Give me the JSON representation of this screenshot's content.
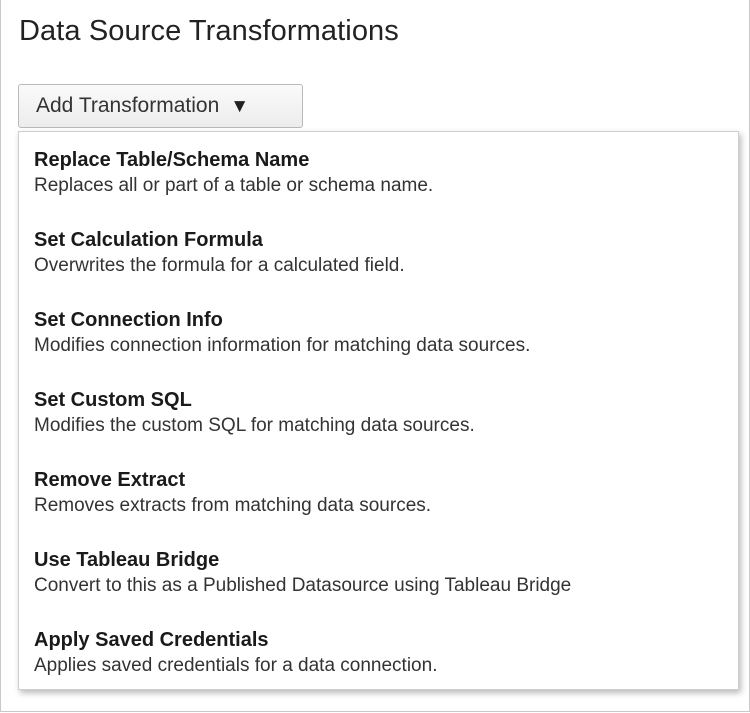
{
  "header": {
    "title": "Data Source Transformations"
  },
  "add_button": {
    "label": "Add Transformation",
    "icon": "caret-down-icon"
  },
  "menu": {
    "items": [
      {
        "name": "Replace Table/Schema Name",
        "description": "Replaces all or part of a table or schema name."
      },
      {
        "name": "Set Calculation Formula",
        "description": "Overwrites the formula for a calculated field."
      },
      {
        "name": "Set Connection Info",
        "description": "Modifies connection information for matching data sources."
      },
      {
        "name": "Set Custom SQL",
        "description": "Modifies the custom SQL for matching data sources."
      },
      {
        "name": "Remove Extract",
        "description": "Removes extracts from matching data sources."
      },
      {
        "name": "Use Tableau Bridge",
        "description": "Convert to this as a Published Datasource using Tableau Bridge"
      },
      {
        "name": "Apply Saved Credentials",
        "description": "Applies saved credentials for a data connection."
      }
    ]
  }
}
